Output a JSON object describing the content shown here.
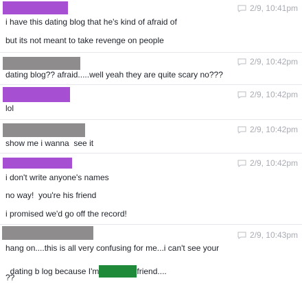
{
  "colors": {
    "purple": "#a64fd3",
    "gray": "#8f8c8e",
    "redaction_green": "#1e8a3a",
    "timestamp": "#a8abb2"
  },
  "icon": "chat-bubble-icon",
  "messages": [
    {
      "sender_color": "purple",
      "timestamp": "2/9, 10:41pm",
      "lines": [
        "i have this dating blog that he's kind of afraid of",
        "but its not meant to take revenge on people"
      ]
    },
    {
      "sender_color": "gray",
      "timestamp": "2/9, 10:42pm",
      "lines": [
        "dating blog?? afraid.....well yeah they are quite scary no???"
      ]
    },
    {
      "sender_color": "purple",
      "timestamp": "2/9, 10:42pm",
      "lines": [
        "lol"
      ]
    },
    {
      "sender_color": "gray",
      "timestamp": "2/9, 10:42pm",
      "lines": [
        "show me i wanna  see it"
      ]
    },
    {
      "sender_color": "purple",
      "timestamp": "2/9, 10:42pm",
      "lines": [
        "i don't write anyone's names",
        "no way!  you're his friend",
        "i promised we'd go off the record!"
      ]
    },
    {
      "sender_color": "gray",
      "timestamp": "2/9, 10:43pm",
      "lines": [
        "hang on....this is all very confusing for me...i can't see your",
        "dating b log because I'm",
        "friend....",
        "??"
      ]
    }
  ]
}
